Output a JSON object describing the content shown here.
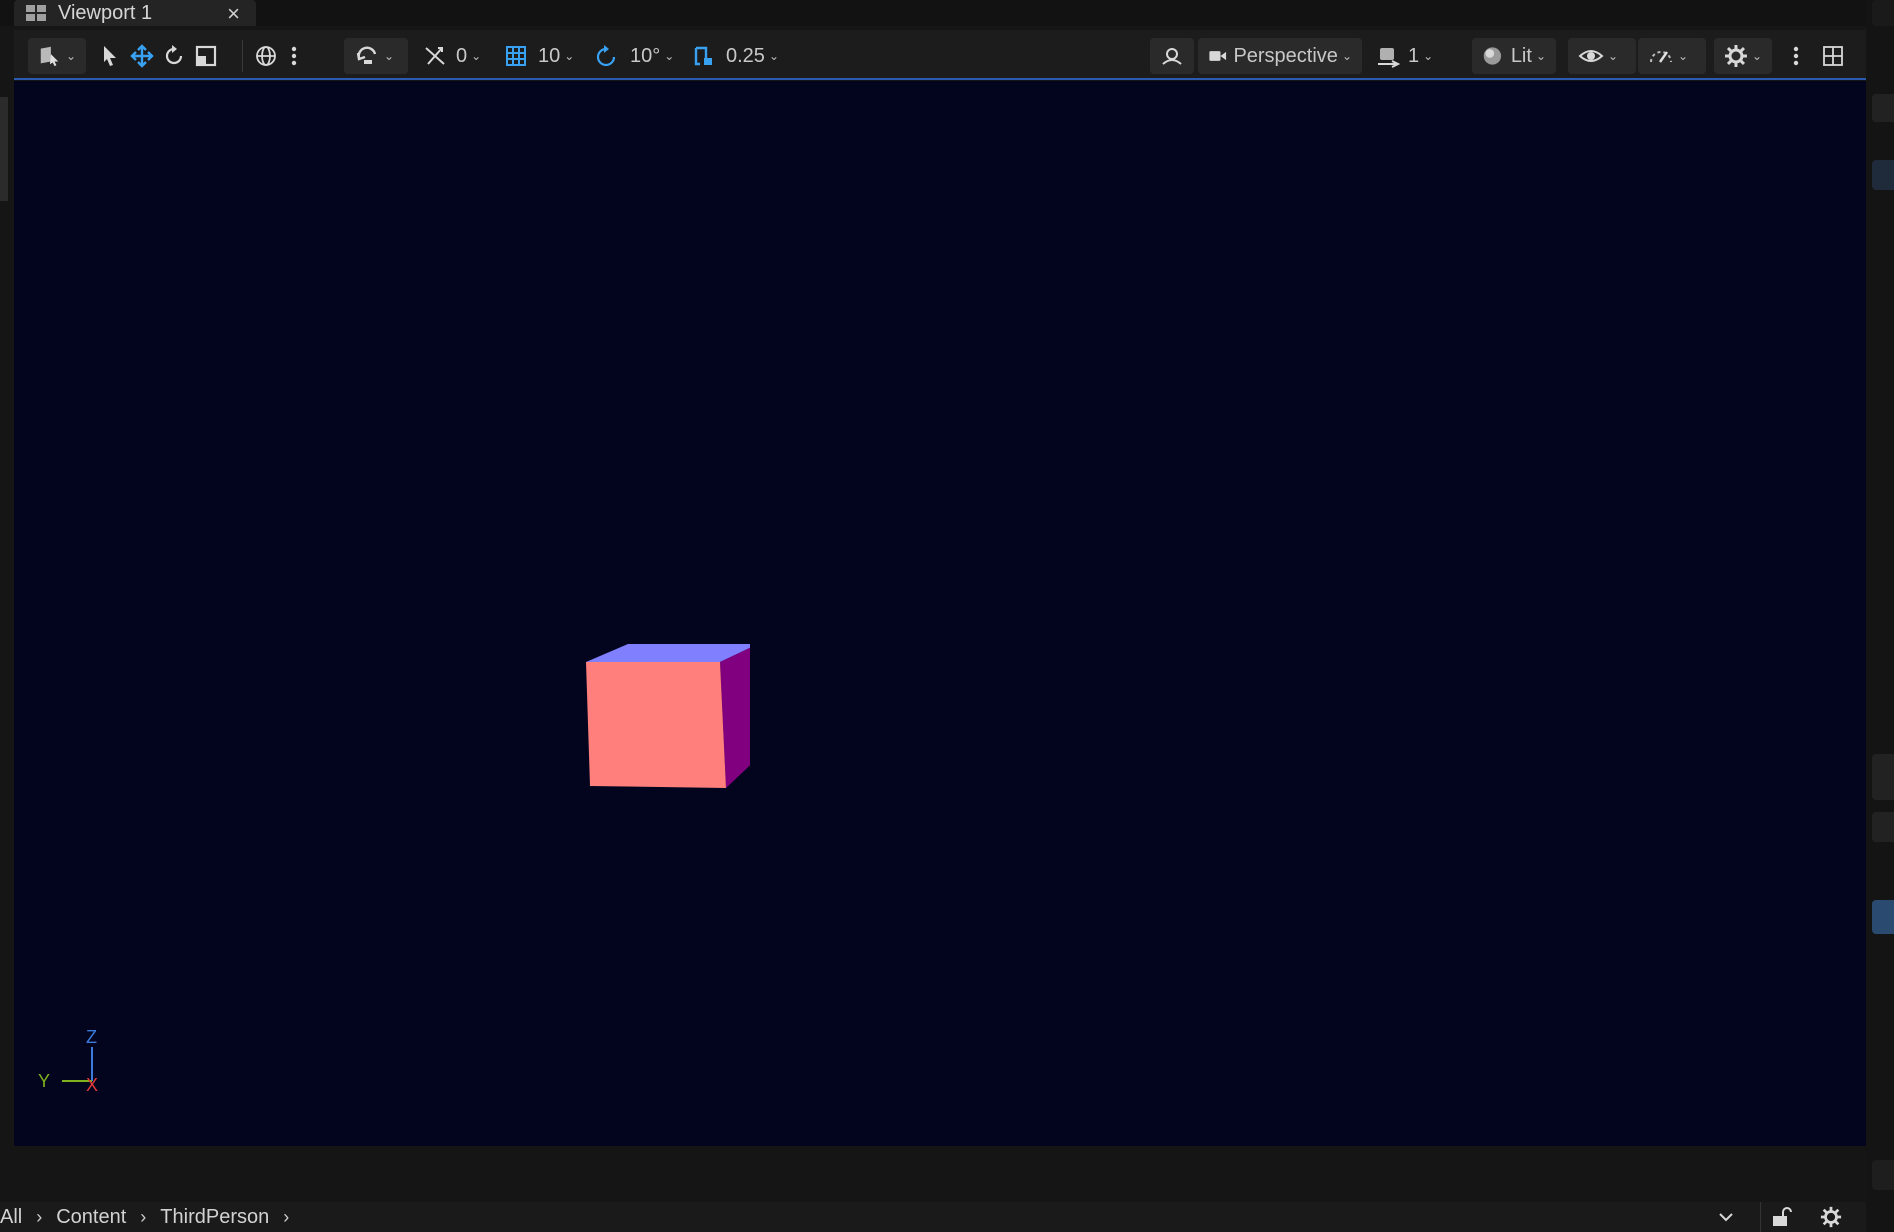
{
  "tab": {
    "icon": "viewport-grid-icon",
    "title": "Viewport 1",
    "close_label": "×"
  },
  "toolbar": {
    "selection_mode_icon": "select-mode-icon",
    "select_icon": "pointer-icon",
    "translate_icon": "move-icon",
    "rotate_icon": "rotate-icon",
    "scale_icon": "scale-icon",
    "world_icon": "globe-icon",
    "more_icon": "vertical-dots-icon",
    "surface_snap_icon": "surface-snap-icon",
    "snap_value": "0",
    "grid_snap_value": "10",
    "rotation_snap_value": "10°",
    "scale_snap_value": "0.25",
    "camera_speed_icon": "camera-speed-icon",
    "view_mode_label": "Perspective",
    "camera_count": "1",
    "lit_label": "Lit",
    "show_icon": "eye-icon",
    "performance_icon": "realtime-icon",
    "settings_icon": "gear-icon",
    "layout_icon": "layout-grid-icon",
    "accent_color": "#38a1f2"
  },
  "viewport": {
    "background_color": "#03051e",
    "cube_colors": {
      "front": "#ff7f7d",
      "top": "#8080ff",
      "side": "#800080"
    },
    "axis": {
      "z_label": "Z",
      "y_label": "Y",
      "x_label": "X",
      "z_color": "#3b7bdc",
      "y_color": "#7fb21c",
      "x_color": "#e03a3a"
    }
  },
  "breadcrumb": {
    "items": [
      "All",
      "Content",
      "ThirdPerson"
    ],
    "separator": "›"
  },
  "bottom_right": {
    "dropdown_icon": "chevron-down-icon",
    "lock_icon": "unlock-icon",
    "settings_icon": "gear-icon"
  }
}
